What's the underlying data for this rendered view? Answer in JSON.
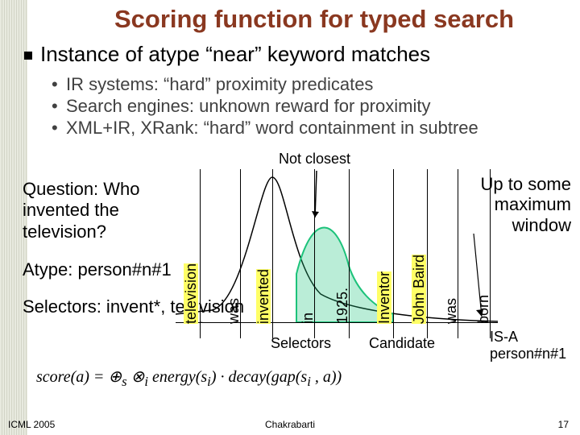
{
  "title": "Scoring function for typed search",
  "main_bullet": "Instance of atype “near” keyword matches",
  "sub_bullets": [
    "IR systems: “hard” proximity predicates",
    "Search engines: unknown reward for proximity",
    "XML+IR, XRank: “hard” word containment in subtree"
  ],
  "left": {
    "question_label": "Question: Who invented the television?",
    "atype_label": "Atype: person#n#1",
    "selectors_label": "Selectors: invent*, television"
  },
  "diagram": {
    "not_closest": "Not closest",
    "up_to": "Up to some maximum window",
    "words": [
      "television",
      "was",
      "invented",
      "in",
      "1925.",
      "Inventor",
      "John Baird",
      "was",
      "born"
    ],
    "selectors_caption": "Selectors",
    "candidate_caption": "Candidate",
    "isa": "IS-A person#n#1"
  },
  "formula": "score(a) = ⊕s ⊗i energy(si) · decay(gap(si , a))",
  "footer": {
    "left": "ICML 2005",
    "center": "Chakrabarti",
    "right": "17"
  }
}
